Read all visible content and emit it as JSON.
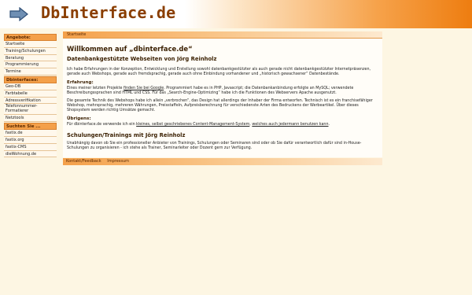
{
  "header": {
    "title": "DbInterface.de",
    "logo_icon": "arrow-right-icon",
    "accent": "#ee7d10"
  },
  "sidebar": {
    "section1": {
      "title": "Angebote:",
      "items": [
        "Startseite",
        "Training/Schulungen",
        "Beratung",
        "Programmierung",
        "Termine"
      ]
    },
    "section2": {
      "title": "Dbinterfaces:",
      "items": [
        "Geo-DB",
        "Farbtabelle",
        "Adressverifikation",
        "Telefonnummer-Formatierer",
        "Netztools"
      ]
    },
    "section3": {
      "title": "Suchten Sie ...",
      "items": [
        "fastix.de",
        "fastix.org",
        "fastix-CMS",
        "dieWohnung.de"
      ]
    }
  },
  "main": {
    "breadcrumb": "Startseite",
    "h1": "Willkommen auf „dbinterface.de“",
    "h2_intro": "Datenbankgestützte Webseiten von Jörg Reinholz",
    "p_intro_1": "Ich habe Erfahrungen in der Konzeption, Entwicklung und Erstellung sowohl datenbankgestützter als auch gerade nicht datenbankgestützter Internetpräsenzen, gerade auch Webshops, gerade auch fremdsprachig, gerade auch ohne Einbindung vorhandener und „historisch gewachsener“ Datenbestände.",
    "h3_experience": "Erfahrung:",
    "p_exp_1a": "Eines meiner letzten Projekte ",
    "p_exp_1_link": "finden Sie bei Google",
    "p_exp_1b": ". Programmiert habe es in PHP, Javascript; die Datenbankanbindung erfolgte an MySQL; verwendete Beschreibungssprachen sind HTML und CSS. Für das „Search-Engine-Optimizing“ habe ich die Funktionen des Webservers Apache ausgenutzt.",
    "p_exp_2": "Die gesamte Technik des Webshops habe ich allein „verbrochen“, das Design hat allerdings der Inhaber der Firma entworfen. Technisch ist es ein franchisefähiger Webshop, mehrsprachig, mehreren Währungen, Preisstaffeln, Aufpreisberechnung für verschiedenste Arten des Bedruckens der Werbeartikel. Über dieses Shopsystem werden richtig Umsätze gemacht.",
    "h3_more": "Übrigens:",
    "p_more_a": "Für dbinterface.de verwende ich ein ",
    "p_more_link1": "kleines, selbst geschriebenes Content-Management-System",
    "p_more_b": ", ",
    "p_more_link2": "welches auch jedermann benutzen kann",
    "p_more_c": ".",
    "h2_training": "Schulungen/Trainings mit Jörg Reinholz",
    "p_training": "Unabhängig davon ob Sie ein professioneller Anbieter von Trainings, Schulungen oder Seminaren sind oder ob Sie dafür verantwortlich dafür sind in-House-Schulungen zu organisieren - ich stehe als Trainer, Seminarleiter oder Dozent gern zur Verfügung."
  },
  "footer": {
    "links": [
      "Kontakt/Feedback",
      "Impressum"
    ]
  }
}
